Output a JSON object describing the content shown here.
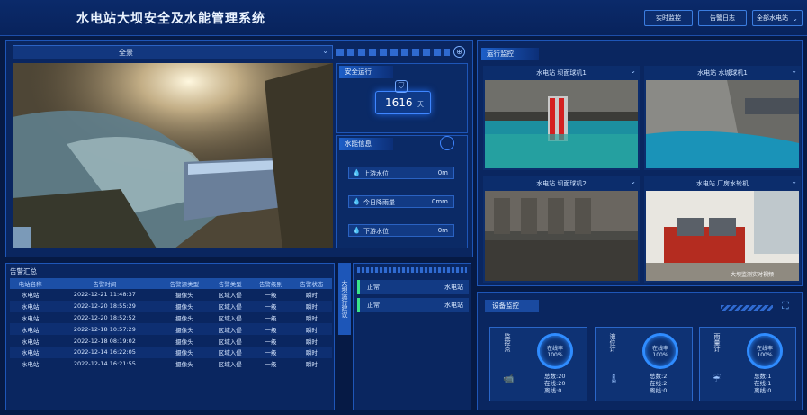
{
  "header": {
    "title": "水电站大坝安全及水能管理系统",
    "btn_monitor": "实时监控",
    "btn_log": "告警日志",
    "btn_station": "全部水电站"
  },
  "panorama": {
    "label": "全景"
  },
  "safety": {
    "title": "安全运行",
    "days_value": "1616",
    "days_unit": "天"
  },
  "water": {
    "title": "水能信息",
    "items": [
      {
        "label": "上游水位",
        "value": "0m"
      },
      {
        "label": "今日降雨量",
        "value": "0mm"
      },
      {
        "label": "下游水位",
        "value": "0m"
      }
    ]
  },
  "alarm": {
    "title": "告警汇总",
    "columns": [
      "电站名称",
      "告警时间",
      "告警源类型",
      "告警类型",
      "告警级别",
      "告警状态"
    ],
    "rows": [
      [
        "水电站",
        "2022-12-21 11:48:37",
        "摄像头",
        "区域入侵",
        "一级",
        "瞬时"
      ],
      [
        "水电站",
        "2022-12-20 18:55:29",
        "摄像头",
        "区域入侵",
        "一级",
        "瞬时"
      ],
      [
        "水电站",
        "2022-12-20 18:52:52",
        "摄像头",
        "区域入侵",
        "一级",
        "瞬时"
      ],
      [
        "水电站",
        "2022-12-18 10:57:29",
        "摄像头",
        "区域入侵",
        "一级",
        "瞬时"
      ],
      [
        "水电站",
        "2022-12-18 08:19:02",
        "摄像头",
        "区域入侵",
        "一级",
        "瞬时"
      ],
      [
        "水电站",
        "2022-12-14 16:22:05",
        "摄像头",
        "区域入侵",
        "一级",
        "瞬时"
      ],
      [
        "水电站",
        "2022-12-14 16:21:55",
        "摄像头",
        "区域入侵",
        "一级",
        "瞬时"
      ]
    ]
  },
  "dam_advice": {
    "title": "大坝运行建议",
    "rows": [
      {
        "status": "正常",
        "station": "水电站"
      },
      {
        "status": "正常",
        "station": "水电站"
      }
    ]
  },
  "run_monitor": {
    "title": "运行监控",
    "cameras": [
      {
        "title": "水电站 坝面球机1"
      },
      {
        "title": "水电站 水城球机1"
      },
      {
        "title": "水电站 坝面球机2"
      },
      {
        "title": "水电站 厂房水轮机"
      }
    ],
    "watermark": "大坝监测实时视频"
  },
  "devices": {
    "title": "设备监控",
    "cards": [
      {
        "label": "监控点",
        "ring_label": "在线率",
        "ring_value": "100%",
        "total": "总数:20",
        "online": "在线:20",
        "offline": "离线:0"
      },
      {
        "label": "液位计",
        "ring_label": "在线率",
        "ring_value": "100%",
        "total": "总数:2",
        "online": "在线:2",
        "offline": "离线:0"
      },
      {
        "label": "雨量计",
        "ring_label": "在线率",
        "ring_value": "100%",
        "total": "总数:1",
        "online": "在线:1",
        "offline": "离线:0"
      }
    ]
  }
}
